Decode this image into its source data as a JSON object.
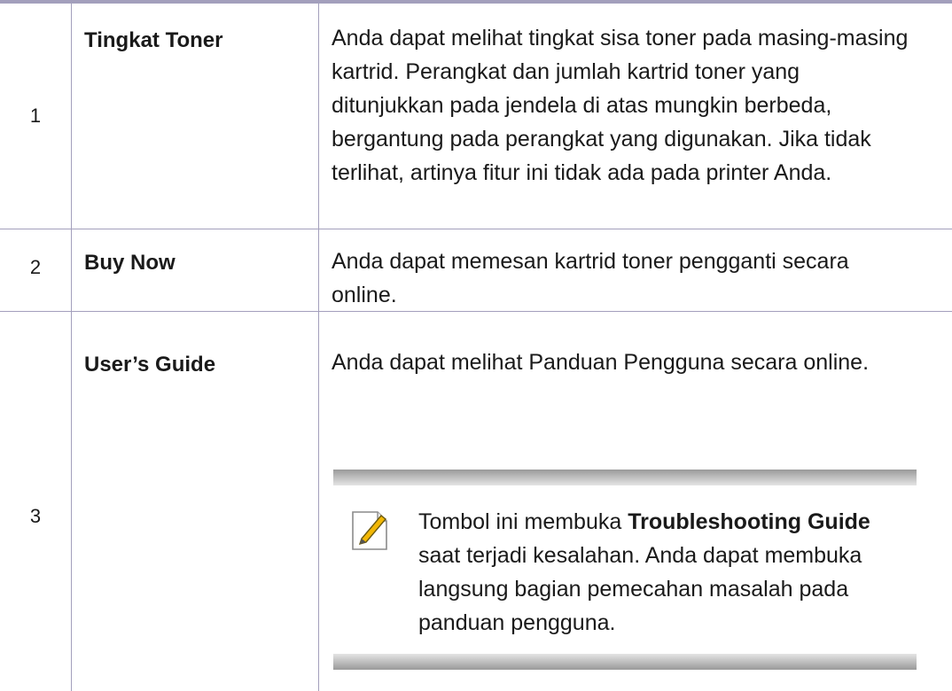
{
  "rows": [
    {
      "num": "1",
      "term": "Tingkat Toner",
      "desc": "Anda dapat melihat tingkat sisa toner pada masing-masing kartrid. Perangkat dan jumlah kartrid toner yang ditunjukkan pada jendela di atas mungkin berbeda, bergantung pada perangkat yang digunakan. Jika tidak terlihat, artinya fitur ini tidak ada pada printer Anda."
    },
    {
      "num": "2",
      "term": "Buy Now",
      "desc": "Anda dapat memesan kartrid toner pengganti secara online."
    },
    {
      "num": "3",
      "term": "User’s Guide",
      "desc": "Anda dapat melihat Panduan Pengguna secara online.",
      "note": {
        "icon": "note-pencil-icon",
        "text_before": "Tombol ini membuka ",
        "bold": "Troubleshooting Guide",
        "text_after": " saat terjadi kesalahan. Anda dapat membuka langsung bagian pemecahan masalah pada panduan pengguna."
      }
    }
  ],
  "colors": {
    "rule": "#a39fbc",
    "note_bar": "#9a9a9a",
    "icon_accent": "#f2b705"
  }
}
